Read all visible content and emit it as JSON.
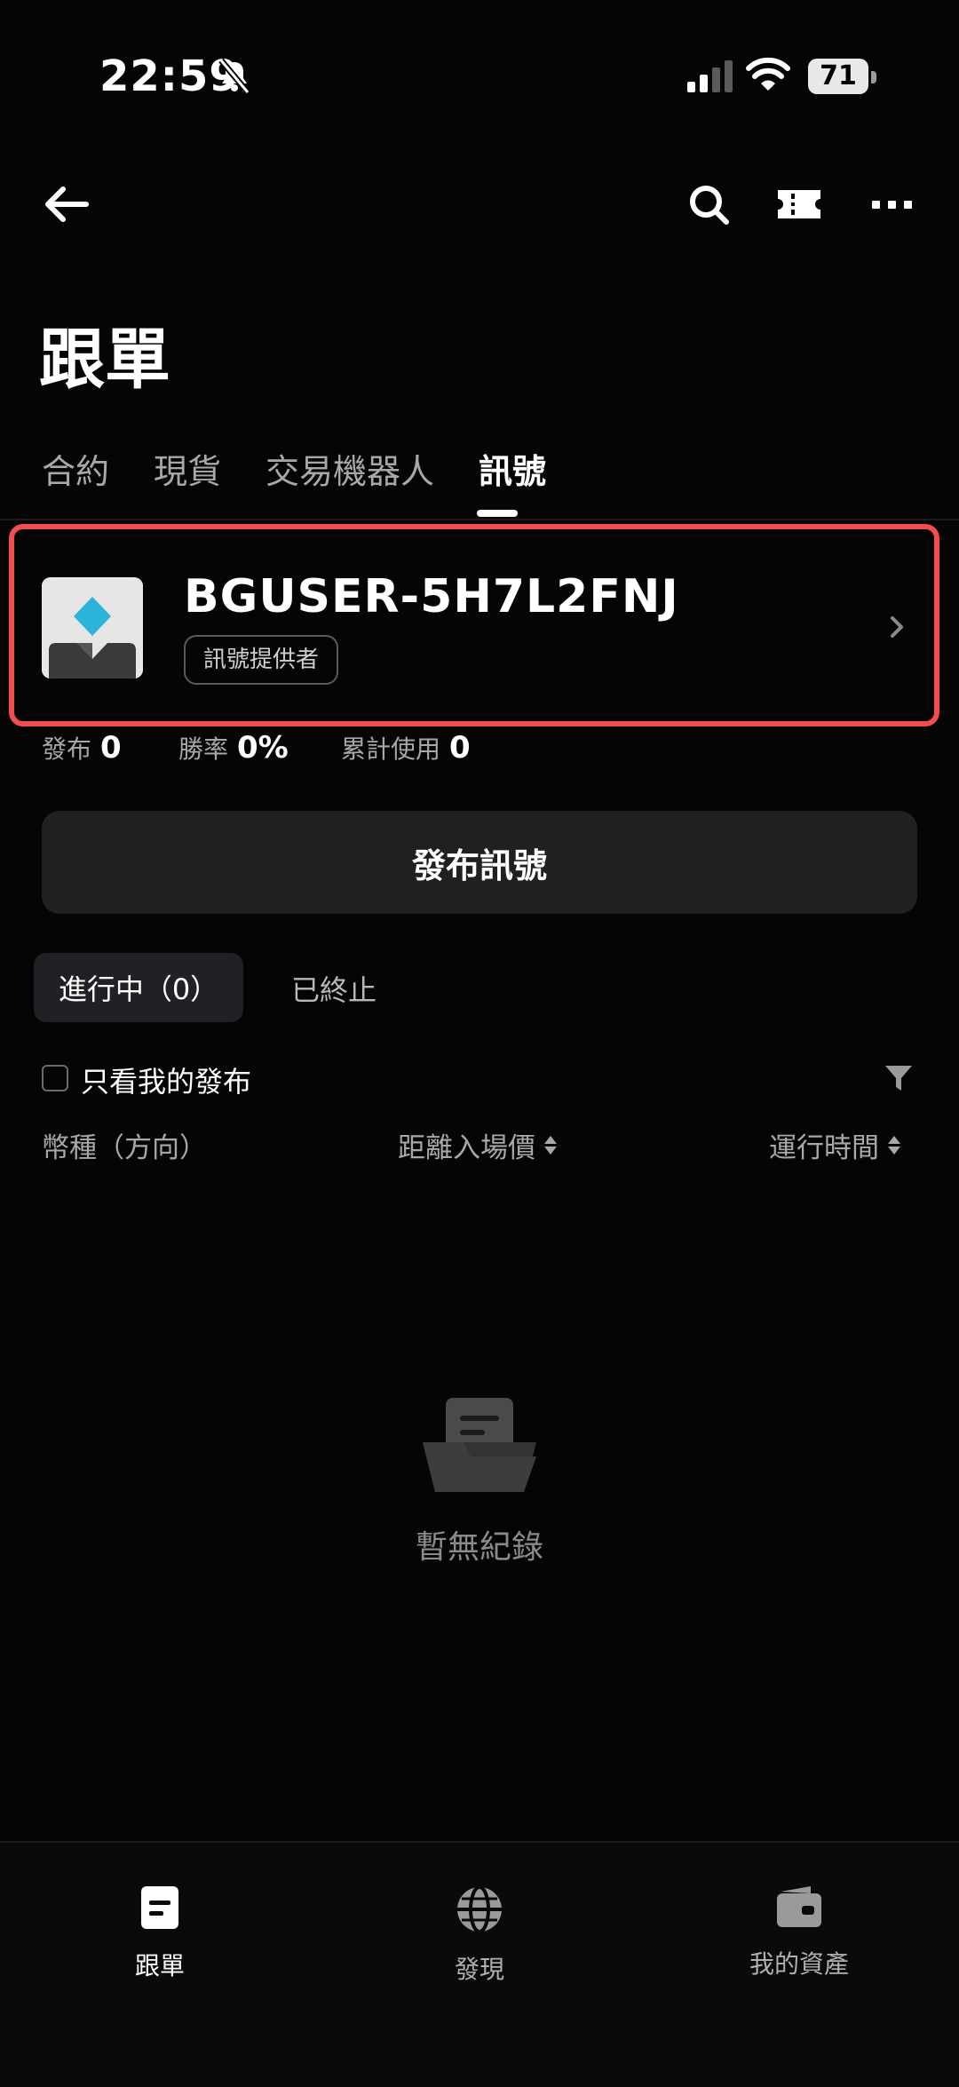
{
  "status_bar": {
    "time": "22:59",
    "battery": "71"
  },
  "page": {
    "title": "跟單"
  },
  "tabs": [
    {
      "label": "合約"
    },
    {
      "label": "現貨"
    },
    {
      "label": "交易機器人"
    },
    {
      "label": "訊號"
    }
  ],
  "profile": {
    "username": "BGUSER-5H7L2FNJ",
    "badge": "訊號提供者"
  },
  "stats": [
    {
      "label": "發布",
      "value": "0"
    },
    {
      "label": "勝率",
      "value": "0%"
    },
    {
      "label": "累計使用",
      "value": "0"
    }
  ],
  "publish_button": "發布訊號",
  "segments": {
    "active": "進行中（0）",
    "inactive": "已終止"
  },
  "filter": {
    "checkbox_label": "只看我的發布"
  },
  "columns": [
    "幣種（方向）",
    "距離入場價",
    "運行時間"
  ],
  "empty_text": "暫無紀錄",
  "bottom_nav": [
    {
      "label": "跟單"
    },
    {
      "label": "發現"
    },
    {
      "label": "我的資產"
    }
  ],
  "colors": {
    "highlight_border": "#f24d4d",
    "avatar_diamond": "#2bb3d9"
  }
}
